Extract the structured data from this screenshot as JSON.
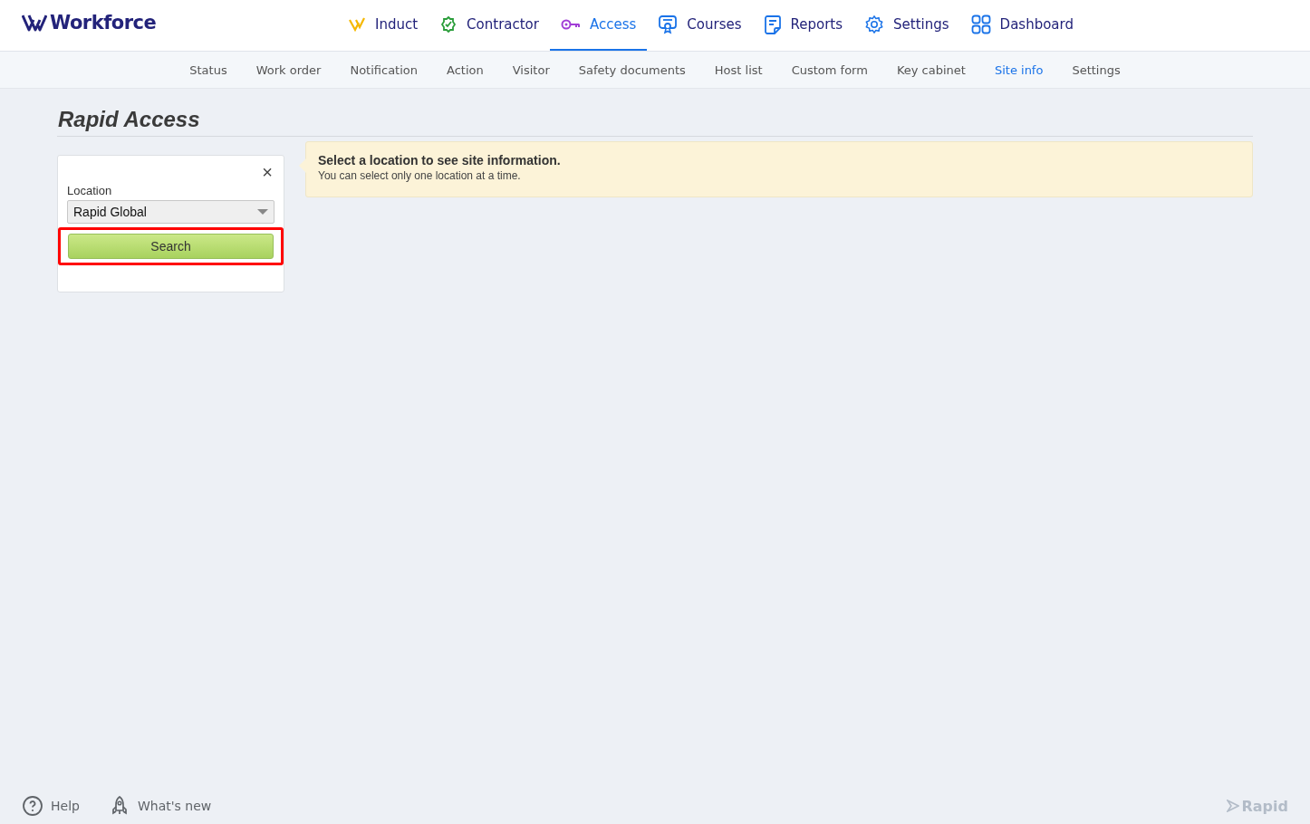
{
  "brand": {
    "name": "Workforce"
  },
  "main_nav": [
    {
      "label": "Induct",
      "selected": false
    },
    {
      "label": "Contractor",
      "selected": false
    },
    {
      "label": "Access",
      "selected": true
    },
    {
      "label": "Courses",
      "selected": false
    },
    {
      "label": "Reports",
      "selected": false
    },
    {
      "label": "Settings",
      "selected": false
    },
    {
      "label": "Dashboard",
      "selected": false
    }
  ],
  "sub_nav": [
    {
      "label": "Status",
      "selected": false
    },
    {
      "label": "Work order",
      "selected": false
    },
    {
      "label": "Notification",
      "selected": false
    },
    {
      "label": "Action",
      "selected": false
    },
    {
      "label": "Visitor",
      "selected": false
    },
    {
      "label": "Safety documents",
      "selected": false
    },
    {
      "label": "Host list",
      "selected": false
    },
    {
      "label": "Custom form",
      "selected": false
    },
    {
      "label": "Key cabinet",
      "selected": false
    },
    {
      "label": "Site info",
      "selected": true
    },
    {
      "label": "Settings",
      "selected": false
    }
  ],
  "page_title": "Rapid Access",
  "filter_panel": {
    "close": "×",
    "location_label": "Location",
    "location_value": "Rapid Global",
    "search_button": "Search",
    "search_highlighted": true
  },
  "notice": {
    "title": "Select a location to see site information.",
    "text": "You can select only one location at a time."
  },
  "footer": {
    "links": [
      "Help",
      "What's new"
    ],
    "logo": "Rapid"
  }
}
